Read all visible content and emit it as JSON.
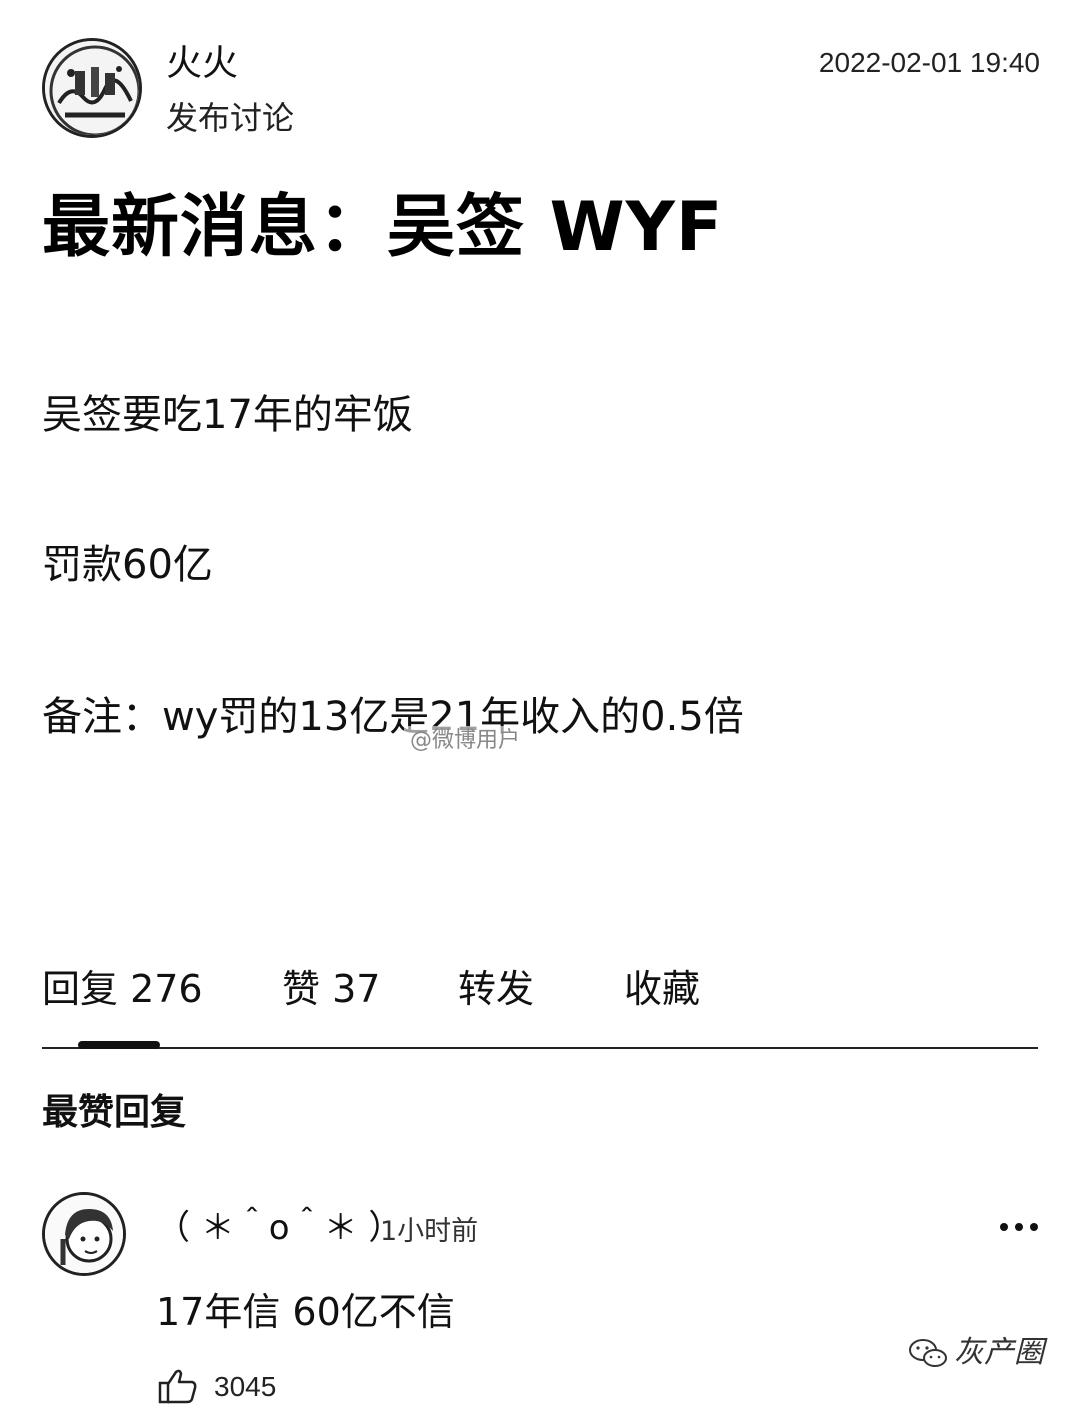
{
  "author": {
    "name": "火火",
    "action": "发布讨论",
    "time": "2022-02-01 19:40"
  },
  "post": {
    "title": "最新消息：吴签 WYF",
    "paragraphs": [
      "吴签要吃17年的牢饭",
      "罚款60亿",
      "备注：wy罚的13亿是21年收入的0.5倍"
    ]
  },
  "watermark_mid": "@微博用户",
  "tabs": [
    {
      "label": "回复 276"
    },
    {
      "label": "赞 37"
    },
    {
      "label": "转发"
    },
    {
      "label": "收藏"
    }
  ],
  "section_title": "最赞回复",
  "comment": {
    "author": "（ ＊＾o＾＊ ）",
    "time": "1小时前",
    "text": "17年信 60亿不信",
    "likes": "3045"
  },
  "brand": {
    "text": "灰产圈",
    "icon": "wechat-icon"
  },
  "icons": {
    "more": "more-dots-icon",
    "like": "thumbs-up-icon"
  }
}
